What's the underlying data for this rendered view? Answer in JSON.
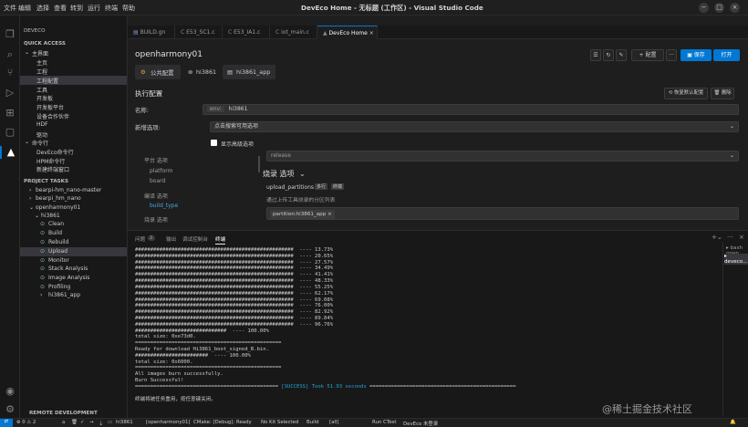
{
  "window": {
    "title": "DevEco Home - 无标题 (工作区) - Visual Studio Code",
    "controls": [
      "−",
      "□",
      "×"
    ]
  },
  "menu": [
    "文件",
    "编辑",
    "选择",
    "查看",
    "转到",
    "运行",
    "终端",
    "帮助"
  ],
  "sidebar": {
    "header": "DEVECO",
    "quick_access": "QUICK ACCESS",
    "main_group": "主界面",
    "main_items": [
      "主页",
      "工程",
      "工程配置",
      "工具",
      "开发板",
      "开发板平台",
      "设备合作伙伴",
      "HDF",
      "驱动"
    ],
    "command_group": "命令行",
    "command_items": [
      "DevEco命令行",
      "HPM命令行",
      "新建终端窗口"
    ],
    "project_tasks": "PROJECT TASKS",
    "projects": [
      "bearpi-hm_nano-master",
      "bearpi_hm_nano",
      "openharmony01"
    ],
    "device": "hi3861",
    "tasks": [
      "Clean",
      "Build",
      "Rebuild",
      "Upload",
      "Monitor",
      "Stack Analysis",
      "Image Analysis",
      "Profiling",
      "hi3861_app"
    ],
    "remote": "REMOTE DEVELOPMENT"
  },
  "tabs": [
    "BUILD.gn",
    "E53_SC1.c",
    "E53_IA1.c",
    "iot_main.c",
    "DevEco Home"
  ],
  "editor": {
    "project_name": "openharmony01",
    "config_tabs": [
      "公共配置",
      "hi3861",
      "hi3861_app"
    ],
    "toolbar": {
      "add": "+ 配置",
      "save": "保存",
      "open": "打开",
      "more": "···"
    },
    "section_title": "执行配置",
    "restore": "恢复默认配置",
    "delete": "删除",
    "name_label": "名称:",
    "name_prefix": "env:",
    "name_value": "hi3861",
    "new_option_label": "新增选项:",
    "new_option_placeholder": "点击搜索可用选项",
    "show_advanced": "显示高级选项",
    "tree": [
      "平台 选项",
      "platform",
      "board",
      "编译 选项",
      "build_type",
      "烧录 选项"
    ],
    "build_type_value": "release",
    "burn_title": "烧录 选项",
    "upload_label": "upload_partitions",
    "upload_tags": [
      "多行",
      "终端"
    ],
    "upload_desc": "通过上传工具烧录的分区列表",
    "upload_chip": "partition:hi3861_app ×"
  },
  "panel": {
    "tabs": [
      "问题",
      "输出",
      "调试控制台",
      "终端"
    ],
    "problems_count": "2",
    "terminals": [
      "bash open...",
      "deveco..."
    ],
    "progress_lines": [
      {
        "pct": "13.73%"
      },
      {
        "pct": "20.65%"
      },
      {
        "pct": "27.57%"
      },
      {
        "pct": "34.49%"
      },
      {
        "pct": "41.41%"
      },
      {
        "pct": "48.33%"
      },
      {
        "pct": "55.25%"
      },
      {
        "pct": "62.17%"
      },
      {
        "pct": "69.08%"
      },
      {
        "pct": "76.00%"
      },
      {
        "pct": "82.92%"
      },
      {
        "pct": "89.84%"
      },
      {
        "pct": "96.76%"
      }
    ],
    "lines_after": [
      "##############################  ---- 100.00%",
      "total size: 0xe73d0.",
      "================================================",
      "Ready for download Hi3861_boot_signed_B.bin.",
      "########################  ---- 100.00%",
      "total size: 0x6000.",
      "================================================",
      "All images burn successfully.",
      "Burn Successful!"
    ],
    "success_line": "[SUCCESS] Took 51.93 seconds",
    "reuse_notice": "终端将被任务重用，按任意键关闭。"
  },
  "statusbar": {
    "left": "⊗ 0 ⚠ 2",
    "items": [
      "hi3861",
      "[openharmony01]",
      "CMake: [Debug]: Ready",
      "No Kit Selected",
      "Build",
      "[all]",
      "Run CTest",
      "DevEco 未登录"
    ]
  },
  "watermark": "@稀土掘金技术社区",
  "colors": {
    "accent": "#0078d4",
    "success": "#1e8fc7",
    "status_bar": "#1f1f1f"
  }
}
